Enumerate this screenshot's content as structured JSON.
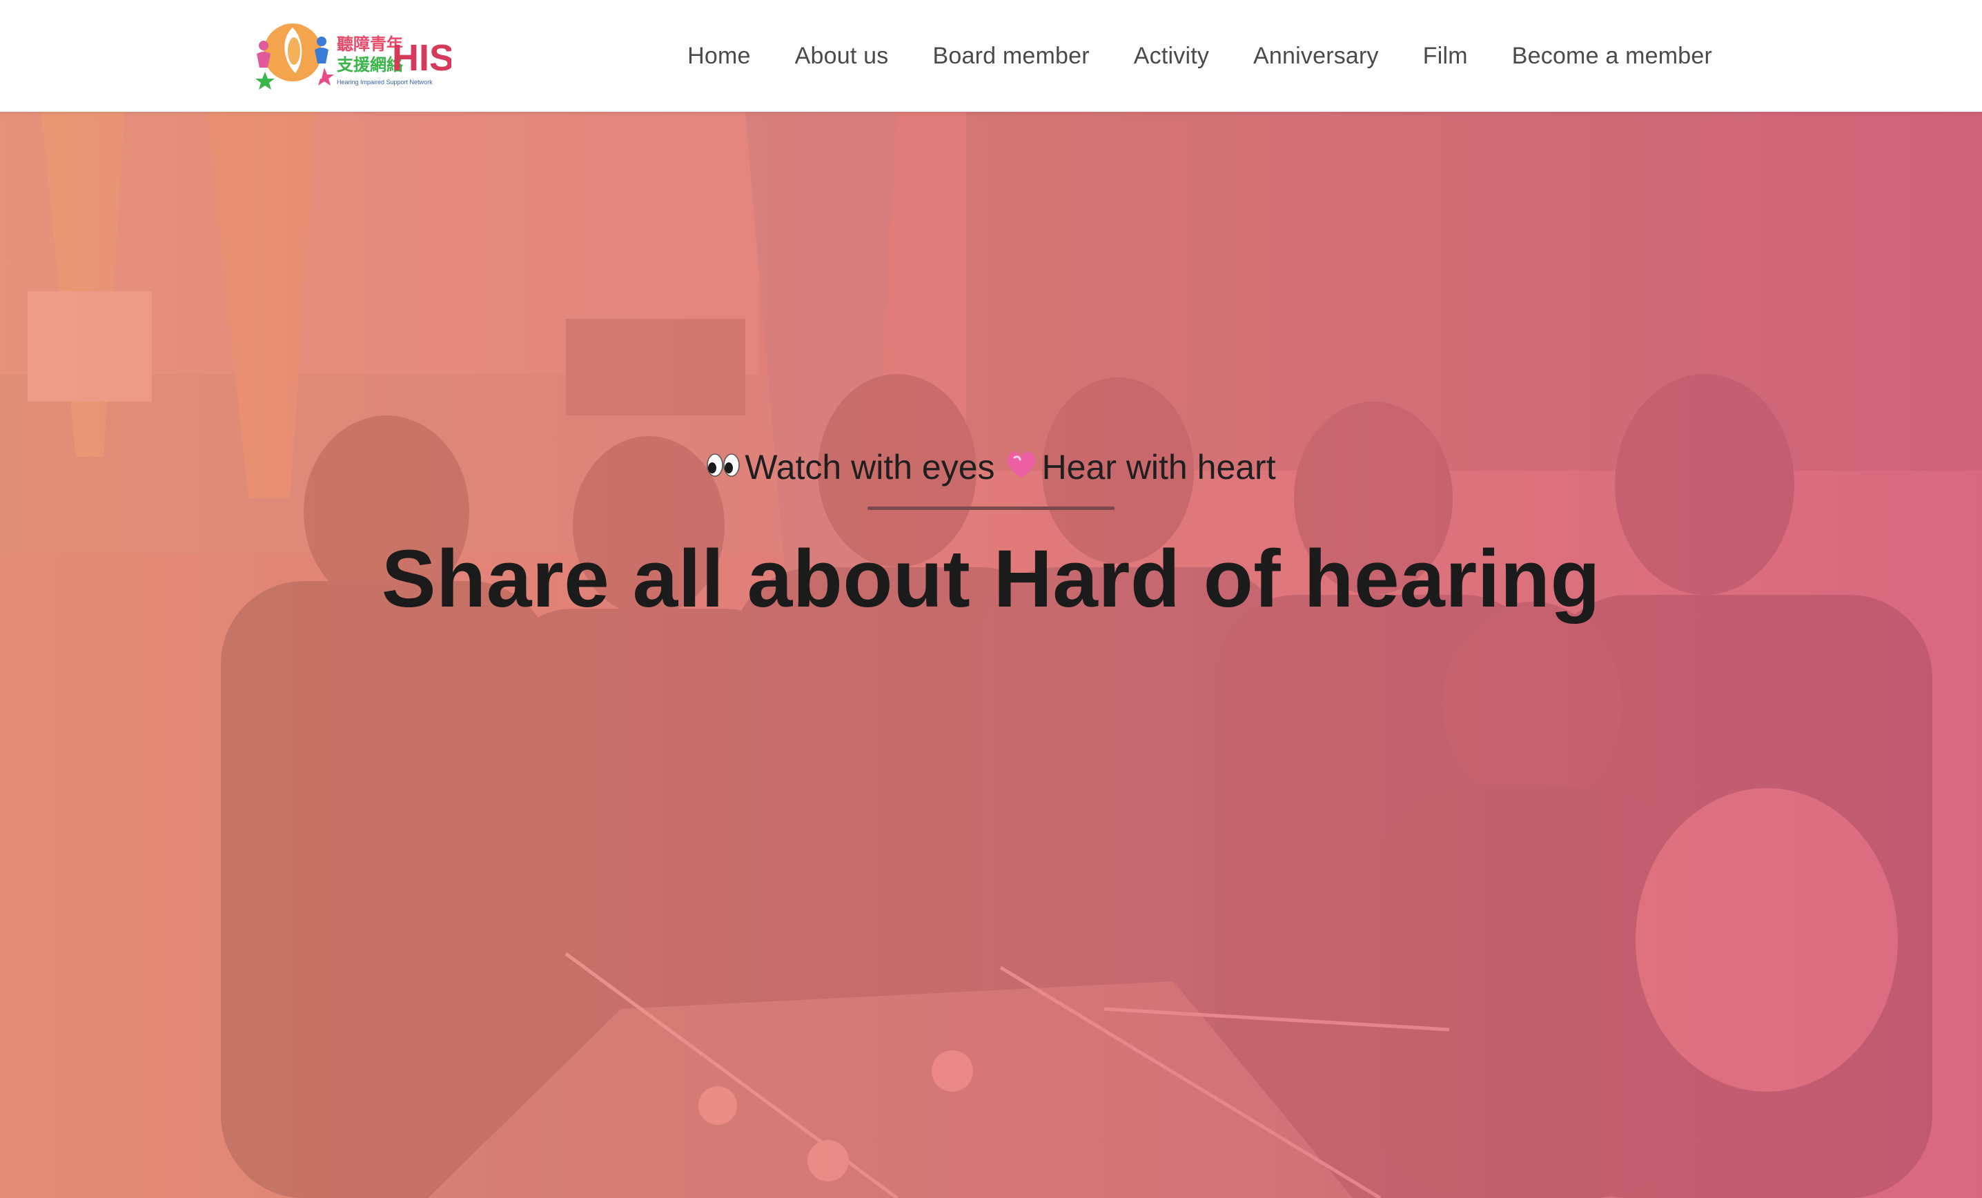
{
  "logo": {
    "chinese_line1": "聽障青年",
    "chinese_line2": "支援網絡",
    "acronym": "HISN",
    "subtitle": "Hearing Impaired Support Network"
  },
  "nav": {
    "items": [
      {
        "label": "Home"
      },
      {
        "label": "About us"
      },
      {
        "label": "Board member"
      },
      {
        "label": "Activity"
      },
      {
        "label": "Anniversary"
      },
      {
        "label": "Film"
      },
      {
        "label": "Become a member"
      }
    ]
  },
  "hero": {
    "tagline_part1": "Watch with eyes",
    "tagline_part2": "Hear with heart",
    "tagline_icons": [
      "eyes-emoji",
      "pink-heart-emoji"
    ],
    "title": "Share all about Hard of hearing"
  },
  "colors": {
    "nav_text": "#4a4a4a",
    "overlay": "#e8767a",
    "heading": "#1b1b1b",
    "divider": "#7a4a4e",
    "heart": "#ec5fa3"
  }
}
